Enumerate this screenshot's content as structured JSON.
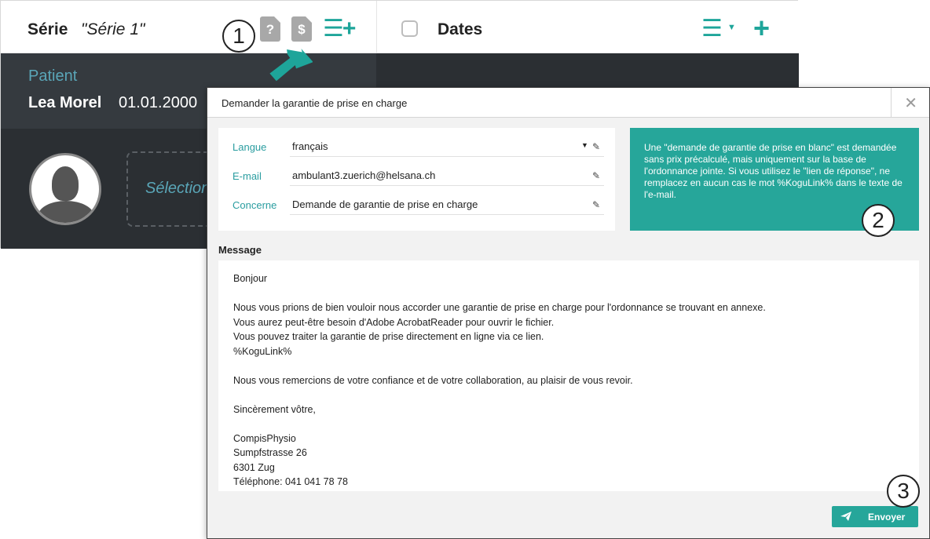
{
  "background_app": {
    "serie_label": "Série",
    "serie_name": "\"Série 1\"",
    "icon_q": "?",
    "icon_d": "$",
    "dates_label": "Dates",
    "patient": {
      "label": "Patient",
      "name": "Lea Morel",
      "dob": "01.01.2000"
    },
    "select_text": "Sélection"
  },
  "callouts": {
    "one": "1",
    "two": "2",
    "three": "3"
  },
  "dialog": {
    "title": "Demander la garantie de prise en charge",
    "close": "✕",
    "fields": {
      "langue_label": "Langue",
      "langue_value": "français",
      "email_label": "E-mail",
      "email_value": "ambulant3.zuerich@helsana.ch",
      "concerne_label": "Concerne",
      "concerne_value": "Demande de garantie de prise en charge"
    },
    "info_text": "Une \"demande de garantie de prise en blanc\" est demandée sans prix précalculé, mais uniquement sur la base de l'ordonnance jointe. Si vous utilisez le \"lien de réponse\", ne remplacez en aucun cas le mot %KoguLink% dans le texte de l'e-mail.",
    "message_label": "Message",
    "message_lines": [
      "Bonjour",
      "",
      "Nous vous prions de bien vouloir nous accorder une garantie de prise en charge pour l'ordonnance se trouvant en annexe.",
      "Vous aurez peut-être besoin d'Adobe AcrobatReader pour ouvrir le fichier.",
      "Vous pouvez traiter la garantie de prise directement en ligne via ce lien.",
      "%KoguLink%",
      "",
      "Nous vous remercions de votre confiance et de votre collaboration, au plaisir de vous revoir.",
      "",
      "Sincèrement vôtre,",
      "",
      "CompisPhysio",
      "Sumpfstrasse 26",
      "6301 Zug",
      "Téléphone: 041 041 78 78"
    ],
    "send_label": "Envoyer"
  },
  "colors": {
    "accent": "#26a69a",
    "dark_panel": "#2b2f33"
  }
}
